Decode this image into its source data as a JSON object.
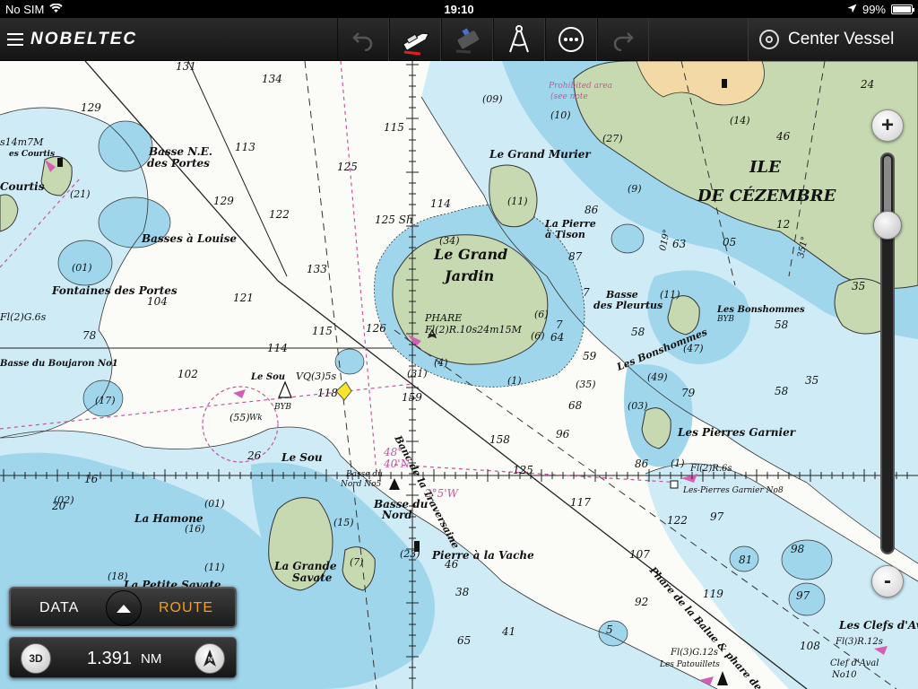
{
  "status_bar": {
    "carrier": "No SIM",
    "time": "19:10",
    "battery": "99%",
    "battery_level": 0.99,
    "icons": [
      "wifi-icon",
      "location-arrow-icon",
      "battery-icon"
    ]
  },
  "toolbar": {
    "brand": "NOBELTEC",
    "tools": [
      "undo-icon",
      "boat-icon",
      "gps-device-icon",
      "compass-divider-icon",
      "more-icon",
      "redo-icon"
    ],
    "center_vessel_label": "Center Vessel"
  },
  "chart": {
    "place_labels": [
      {
        "name": "ile",
        "text": "ILE"
      },
      {
        "name": "de-cezembre",
        "text": "DE CÉZEMBRE"
      },
      {
        "name": "le-grand",
        "text": "Le Grand"
      },
      {
        "name": "jardin",
        "text": "Jardin"
      },
      {
        "name": "le-grand-murier",
        "text": "Le Grand Murier"
      },
      {
        "name": "la-pierre-a-tison",
        "text": "La Pierre"
      },
      {
        "name": "la-pierre-a-tison-2",
        "text": "à Tison"
      },
      {
        "name": "basse-ne-des-portes",
        "text": "Basse N.E."
      },
      {
        "name": "basse-ne-des-portes-2",
        "text": "des Portes"
      },
      {
        "name": "basses-a-louise",
        "text": "Basses à Louise"
      },
      {
        "name": "fontaines-des-portes",
        "text": "Fontaines des Portes"
      },
      {
        "name": "basse-des-pleurtus",
        "text": "Basse"
      },
      {
        "name": "basse-des-pleurtus-2",
        "text": "des Pleurtus"
      },
      {
        "name": "les-bonshommes",
        "text": "Les Bonshommes"
      },
      {
        "name": "les-bonshommes-label",
        "text": "Les Bonshommes"
      },
      {
        "name": "les-pierres-garnier",
        "text": "Les Pierres Garnier"
      },
      {
        "name": "le-sou",
        "text": "Le Sou"
      },
      {
        "name": "le-sou-buoy",
        "text": "Le Sou"
      },
      {
        "name": "la-hamone",
        "text": "La Hamone"
      },
      {
        "name": "la-grande-savate",
        "text": "La Grande"
      },
      {
        "name": "la-grande-savate-2",
        "text": "Savate"
      },
      {
        "name": "la-petite-savate",
        "text": "La Petite Savate"
      },
      {
        "name": "basse-du-nord",
        "text": "Basse du"
      },
      {
        "name": "basse-du-nord-2",
        "text": "Nord"
      },
      {
        "name": "pierre-a-la-vache",
        "text": "Pierre à la Vache"
      },
      {
        "name": "banc-de-la-traversaine",
        "text": "Banc de la Traversaine"
      },
      {
        "name": "les-clefs-d-aval",
        "text": "Les Clefs d'Av"
      },
      {
        "name": "courtis",
        "text": "Courtis"
      },
      {
        "name": "les-courtis",
        "text": "es Courtis"
      },
      {
        "name": "basse-du-boujaron",
        "text": "Basse du Boujaron No1"
      },
      {
        "name": "phare-de-la-balue",
        "text": "Phare de la Balue & phare des Ba"
      }
    ],
    "light_labels": [
      {
        "name": "phare",
        "text": "PHARE"
      },
      {
        "name": "phare-light",
        "text": "Fl(2)R.10s24m15M"
      },
      {
        "name": "vq-light",
        "text": "VQ(3)5s"
      },
      {
        "name": "fl2g-light",
        "text": "Fl(2)G.6s"
      },
      {
        "name": "fl2r6s-light",
        "text": "Fl(2)R.6s"
      },
      {
        "name": "garnier-no8",
        "text": "Les-Pierres Garnier No8"
      },
      {
        "name": "fl3g12s",
        "text": "Fl(3)G.12s"
      },
      {
        "name": "les-patouillets",
        "text": "Les Patouillets"
      },
      {
        "name": "fl3r12s",
        "text": "Fl(3)R.12s"
      },
      {
        "name": "clef-d-aval",
        "text": "Clef d'Aval"
      },
      {
        "name": "no10",
        "text": "No10"
      },
      {
        "name": "basse-du-nord-no5",
        "text": "Basse du"
      },
      {
        "name": "basse-du-nord-no5-2",
        "text": "Nord No5"
      },
      {
        "name": "s14m7m",
        "text": "s14m7M"
      },
      {
        "name": "wk-label",
        "text": "Wk"
      },
      {
        "name": "byb-label",
        "text": "BYB"
      },
      {
        "name": "byb-label-2",
        "text": "BYB"
      },
      {
        "name": "prohibited",
        "text": "Prohibited area"
      },
      {
        "name": "see-note",
        "text": "(see note"
      }
    ],
    "magnetic_labels": [
      {
        "name": "variation-48",
        "text": "48°"
      },
      {
        "name": "variation-40n",
        "text": "40'N"
      },
      {
        "name": "variation-2-5w",
        "text": "2°5'W"
      },
      {
        "name": "bearing-351",
        "text": "351°"
      },
      {
        "name": "bearing-019",
        "text": "019°"
      }
    ],
    "soundings": [
      {
        "text": "131"
      },
      {
        "text": "134"
      },
      {
        "text": "129"
      },
      {
        "text": "115"
      },
      {
        "text": "113"
      },
      {
        "text": "125"
      },
      {
        "text": "129"
      },
      {
        "text": "122"
      },
      {
        "text": "125 Sh"
      },
      {
        "text": "114"
      },
      {
        "text": "133"
      },
      {
        "text": "121"
      },
      {
        "text": "126"
      },
      {
        "text": "115"
      },
      {
        "text": "114"
      },
      {
        "text": "102"
      },
      {
        "text": "118"
      },
      {
        "text": "159"
      },
      {
        "text": "158"
      },
      {
        "text": "125"
      },
      {
        "text": "117"
      },
      {
        "text": "107"
      },
      {
        "text": "122"
      },
      {
        "text": "119"
      },
      {
        "text": "92"
      },
      {
        "text": "108"
      },
      {
        "text": "104"
      },
      {
        "text": "78"
      },
      {
        "text": "86"
      },
      {
        "text": "68"
      },
      {
        "text": "96"
      },
      {
        "text": "97"
      },
      {
        "text": "98"
      },
      {
        "text": "81"
      },
      {
        "text": "97"
      },
      {
        "text": "65"
      },
      {
        "text": "41"
      },
      {
        "text": "38"
      },
      {
        "text": "46"
      },
      {
        "text": "58"
      },
      {
        "text": "79"
      },
      {
        "text": "58"
      },
      {
        "text": "35"
      },
      {
        "text": "58"
      },
      {
        "text": "64"
      },
      {
        "text": "59"
      },
      {
        "text": "87"
      },
      {
        "text": "86"
      },
      {
        "text": "63"
      },
      {
        "text": "12"
      },
      {
        "text": "05"
      },
      {
        "text": "24"
      },
      {
        "text": "46"
      },
      {
        "text": "35"
      },
      {
        "text": "7"
      },
      {
        "text": "7"
      },
      {
        "text": "16"
      },
      {
        "text": "26"
      },
      {
        "text": "20"
      },
      {
        "text": "5"
      }
    ],
    "rocks": [
      {
        "text": "(09)"
      },
      {
        "text": "(10)"
      },
      {
        "text": "(27)"
      },
      {
        "text": "(9)"
      },
      {
        "text": "(14)"
      },
      {
        "text": "(34)"
      },
      {
        "text": "(11)"
      },
      {
        "text": "(6)"
      },
      {
        "text": "(1)"
      },
      {
        "text": "(35)"
      },
      {
        "text": "(31)"
      },
      {
        "text": "(01)"
      },
      {
        "text": "(03)"
      },
      {
        "text": "(49)"
      },
      {
        "text": "(47)"
      },
      {
        "text": "(02)"
      },
      {
        "text": "(01)"
      },
      {
        "text": "(16)"
      },
      {
        "text": "(18)"
      },
      {
        "text": "(11)"
      },
      {
        "text": "(15)"
      },
      {
        "text": "(7)"
      },
      {
        "text": "(23)"
      },
      {
        "text": "(55)"
      },
      {
        "text": "(21)"
      },
      {
        "text": "(11)"
      },
      {
        "text": "(6)"
      },
      {
        "text": "(4)"
      },
      {
        "text": "(1)"
      },
      {
        "text": "(17)"
      }
    ],
    "colors": {
      "land": "#c6d9b0",
      "sand": "#f2d9a6",
      "shallow": "#9fd6ec",
      "mid": "#cfebf5",
      "deep": "#fbfcf8",
      "light_flare": "#d25fb3",
      "line": "#333333",
      "compass": "#c8559e",
      "vessel": "#f5e62a"
    }
  },
  "zoom": {
    "plus_label": "+",
    "minus_label": "-",
    "level": 0.18
  },
  "bottom": {
    "data_label": "DATA",
    "route_label": "ROUTE",
    "mode_3d": "3D",
    "distance_value": "1.391",
    "distance_unit": "NM",
    "north_label": "N"
  }
}
